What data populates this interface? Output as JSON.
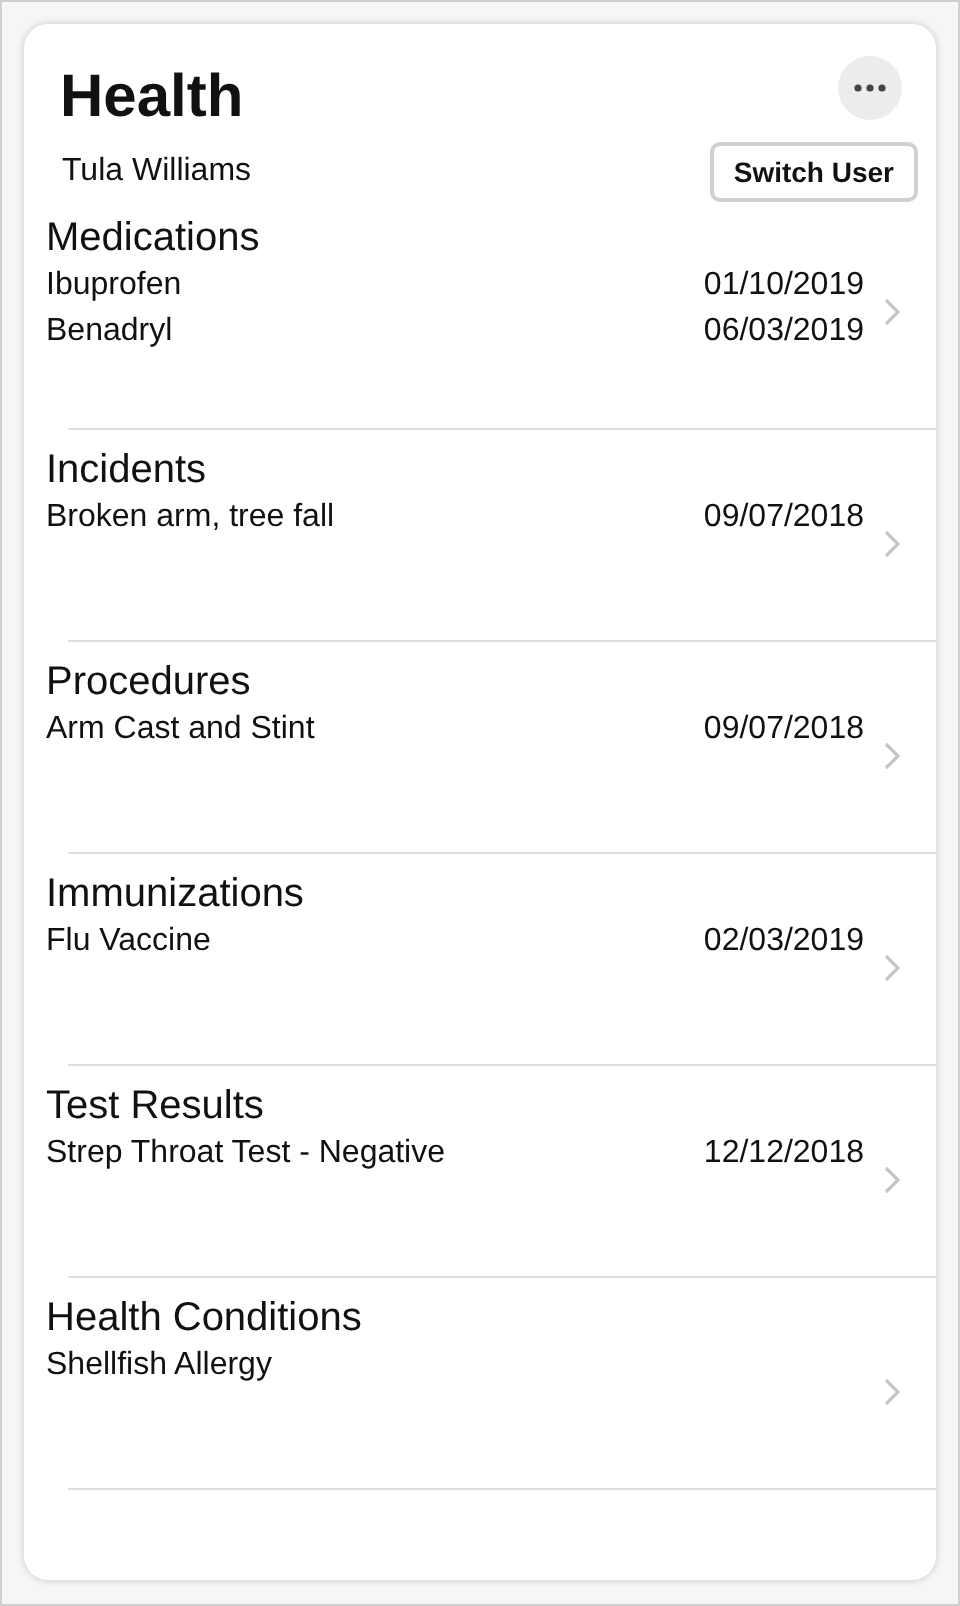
{
  "header": {
    "title": "Health",
    "user_name": "Tula Williams",
    "switch_button": "Switch User"
  },
  "sections": [
    {
      "title": "Medications",
      "items": [
        {
          "name": "Ibuprofen",
          "date": "01/10/2019"
        },
        {
          "name": "Benadryl",
          "date": "06/03/2019"
        }
      ]
    },
    {
      "title": "Incidents",
      "items": [
        {
          "name": "Broken arm, tree fall",
          "date": "09/07/2018"
        }
      ]
    },
    {
      "title": "Procedures",
      "items": [
        {
          "name": "Arm Cast and Stint",
          "date": "09/07/2018"
        }
      ]
    },
    {
      "title": "Immunizations",
      "items": [
        {
          "name": "Flu Vaccine",
          "date": "02/03/2019"
        }
      ]
    },
    {
      "title": "Test Results",
      "items": [
        {
          "name": "Strep Throat Test - Negative",
          "date": "12/12/2018"
        }
      ]
    },
    {
      "title": "Health Conditions",
      "items": [
        {
          "name": "Shellfish Allergy"
        }
      ]
    }
  ]
}
